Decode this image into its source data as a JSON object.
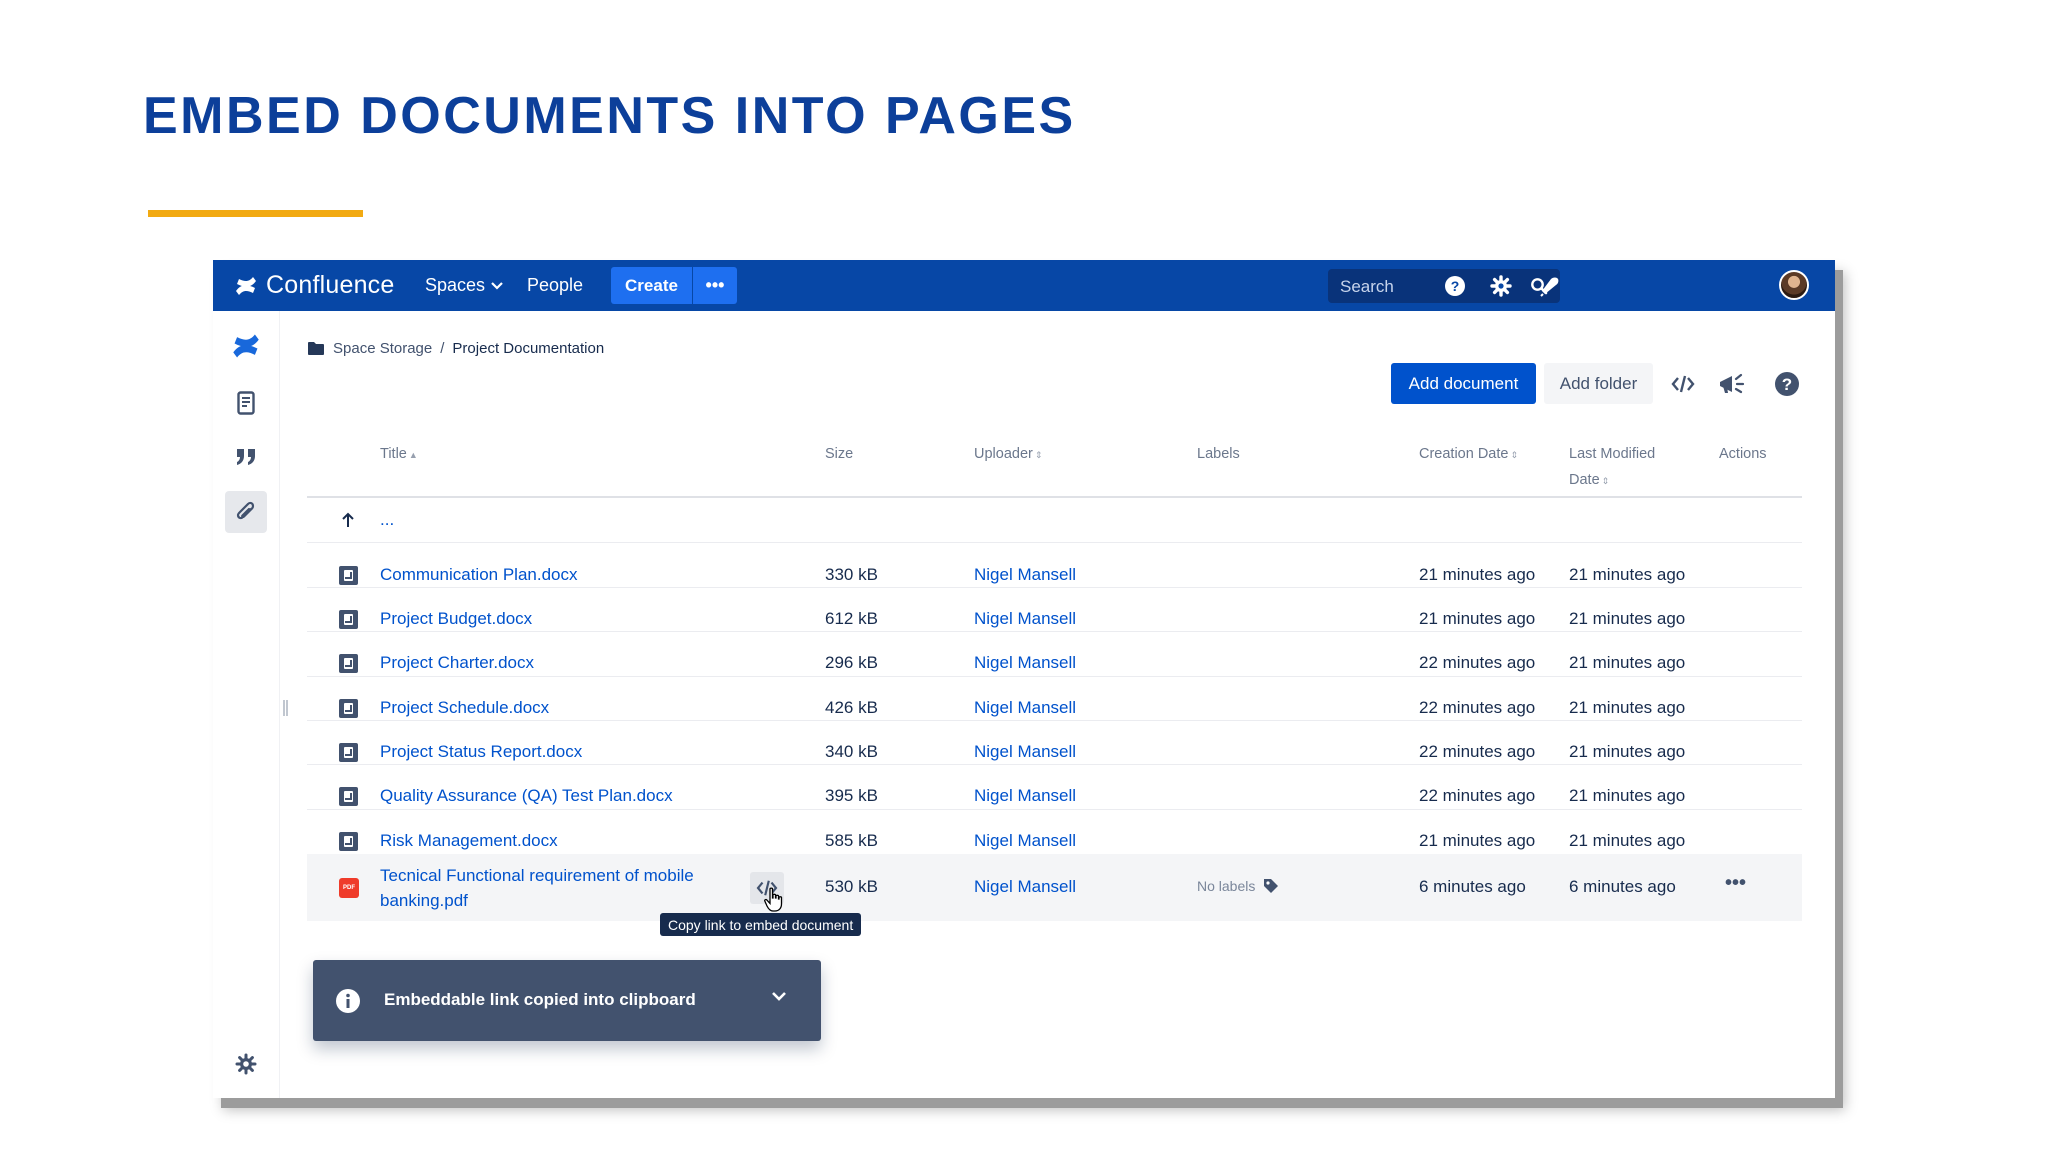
{
  "slide": {
    "title": "EMBED DOCUMENTS INTO PAGES"
  },
  "colors": {
    "nav_bg": "#0747a6",
    "title_blue": "#0c3f9a",
    "accent_line": "#f2aa12",
    "link_blue": "#0052cc",
    "primary_button": "#0052cc",
    "toast_bg": "#42526e"
  },
  "topnav": {
    "brand": "Confluence",
    "spaces": "Spaces",
    "people": "People",
    "create": "Create",
    "more": "•••",
    "search_placeholder": "Search",
    "icons": [
      "help-icon",
      "settings-icon",
      "notifications-icon",
      "avatar"
    ]
  },
  "sidebar": {
    "icons": [
      "confluence-logo-icon",
      "pages-icon",
      "blog-quote-icon",
      "attachments-icon",
      "settings-icon",
      "expand-icon"
    ]
  },
  "breadcrumb": {
    "space": "Space Storage",
    "separator": "/",
    "current": "Project Documentation"
  },
  "toolbar": {
    "add_document": "Add document",
    "add_folder": "Add folder",
    "icons": [
      "embed-code-icon",
      "announce-icon",
      "help-icon"
    ]
  },
  "table": {
    "headers": {
      "title": "Title",
      "size": "Size",
      "uploader": "Uploader",
      "labels": "Labels",
      "creation_date": "Creation Date",
      "last_modified_1": "Last Modified",
      "last_modified_2": "Date",
      "actions": "Actions"
    },
    "parent_row": "...",
    "rows": [
      {
        "title": "Communication Plan.docx",
        "size": "330 kB",
        "uploader": "Nigel Mansell",
        "created": "21 minutes ago",
        "modified": "21 minutes ago"
      },
      {
        "title": "Project Budget.docx",
        "size": "612 kB",
        "uploader": "Nigel Mansell",
        "created": "21 minutes ago",
        "modified": "21 minutes ago"
      },
      {
        "title": "Project Charter.docx",
        "size": "296 kB",
        "uploader": "Nigel Mansell",
        "created": "22 minutes ago",
        "modified": "21 minutes ago"
      },
      {
        "title": "Project Schedule.docx",
        "size": "426 kB",
        "uploader": "Nigel Mansell",
        "created": "22 minutes ago",
        "modified": "21 minutes ago"
      },
      {
        "title": "Project Status Report.docx",
        "size": "340 kB",
        "uploader": "Nigel Mansell",
        "created": "22 minutes ago",
        "modified": "21 minutes ago"
      },
      {
        "title": "Quality Assurance (QA) Test Plan.docx",
        "size": "395 kB",
        "uploader": "Nigel Mansell",
        "created": "22 minutes ago",
        "modified": "21 minutes ago"
      },
      {
        "title": "Risk Management.docx",
        "size": "585 kB",
        "uploader": "Nigel Mansell",
        "created": "21 minutes ago",
        "modified": "21 minutes ago"
      }
    ],
    "pdf_row": {
      "title_line1": "Tecnical Functional requirement of mobile",
      "title_line2": "banking.pdf",
      "file_badge": "PDF",
      "size": "530 kB",
      "uploader": "Nigel Mansell",
      "labels": "No labels",
      "created": "6 minutes ago",
      "modified": "6 minutes ago",
      "actions": "•••"
    }
  },
  "tooltip": "Copy link to embed document",
  "toast": {
    "message": "Embeddable link copied into clipboard"
  }
}
